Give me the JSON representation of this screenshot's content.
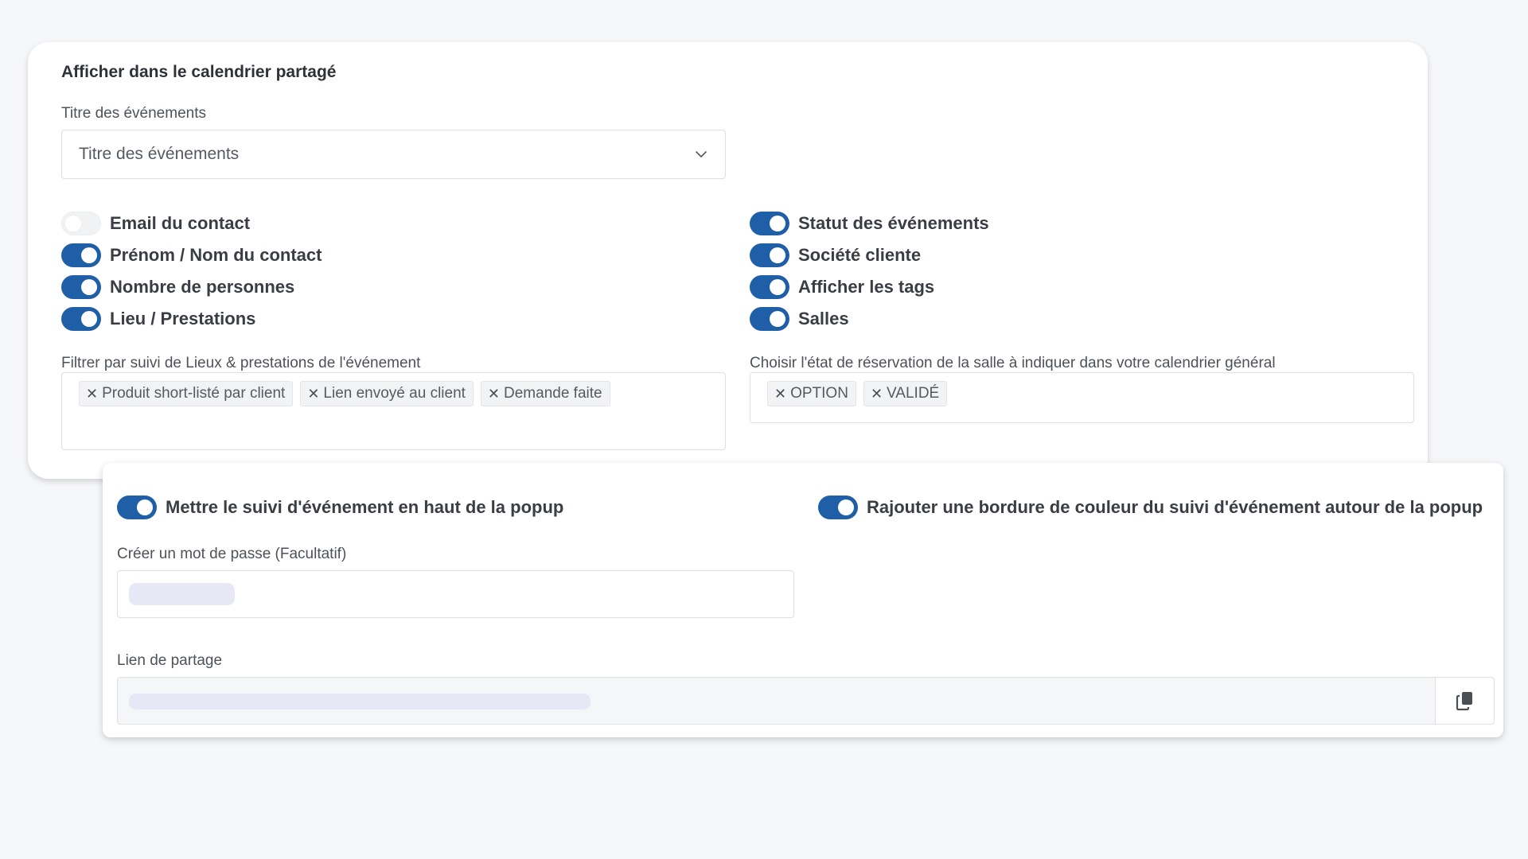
{
  "display_section": {
    "title": "Afficher dans le calendrier partagé",
    "event_title_field": {
      "label": "Titre des événements",
      "value": "Titre des événements"
    },
    "toggles_left": [
      {
        "label": "Email du contact",
        "on": false
      },
      {
        "label": "Prénom / Nom du contact",
        "on": true
      },
      {
        "label": "Nombre de personnes",
        "on": true
      },
      {
        "label": "Lieu / Prestations",
        "on": true
      }
    ],
    "toggles_right": [
      {
        "label": "Statut des événements",
        "on": true
      },
      {
        "label": "Société cliente",
        "on": true
      },
      {
        "label": "Afficher les tags",
        "on": true
      },
      {
        "label": "Salles",
        "on": true
      }
    ],
    "filter_field": {
      "label": "Filtrer par suivi de Lieux & prestations de l'événement",
      "chips": [
        "Produit short-listé par client",
        "Lien envoyé au client",
        "Demande faite"
      ]
    },
    "room_state_field": {
      "label": "Choisir l'état de réservation de la salle à indiquer dans votre calendrier général",
      "chips": [
        "OPTION",
        "VALIDÉ"
      ]
    }
  },
  "popup_section": {
    "toggle_top": {
      "label": "Mettre le suivi d'événement en haut de la popup",
      "on": true
    },
    "toggle_border": {
      "label": "Rajouter une bordure de couleur du suivi d'événement autour de la popup",
      "on": true
    },
    "password_field": {
      "label": "Créer un mot de passe (Facultatif)",
      "value": ""
    },
    "share_link_field": {
      "label": "Lien de partage",
      "value": ""
    }
  },
  "icons": {
    "select_chevron": "chevron-down-icon",
    "chip_remove": "close-icon",
    "copy": "copy-icon"
  },
  "colors": {
    "accent": "#1f5fa7",
    "toggle_off": "#f1f2f4",
    "page_background": "#f6f7f9"
  }
}
